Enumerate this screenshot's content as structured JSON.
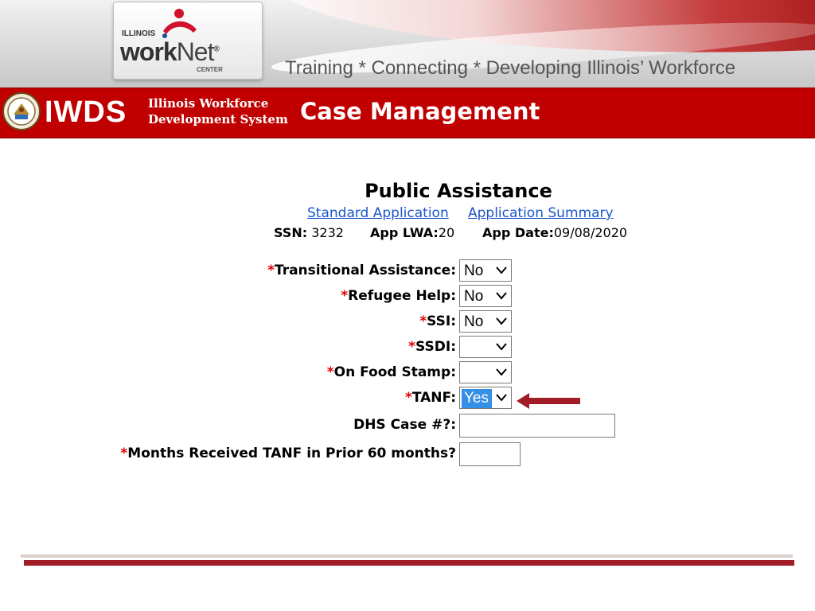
{
  "header": {
    "logo_state": "ILLINOIS",
    "logo_work": "work",
    "logo_net": "Net",
    "logo_trademark": "®",
    "logo_center": "CENTER",
    "tagline": "Training * Connecting * Developing Illinois’ Workforce"
  },
  "system_bar": {
    "acronym": "IWDS",
    "full_name_line1": "Illinois Workforce",
    "full_name_line2": "Development System",
    "module": "Case Management"
  },
  "page": {
    "title": "Public Assistance",
    "links": {
      "standard_application": "Standard Application",
      "application_summary": "Application Summary"
    },
    "info": {
      "ssn_label": "SSN:",
      "ssn_value": "3232",
      "lwa_label": "App LWA:",
      "lwa_value": "20",
      "date_label": "App Date:",
      "date_value": "09/08/2020"
    }
  },
  "form": {
    "required_marker": "*",
    "fields": [
      {
        "label": "Transitional Assistance:",
        "value": "No",
        "required": true
      },
      {
        "label": "Refugee Help:",
        "value": "No",
        "required": true
      },
      {
        "label": "SSI:",
        "value": "No",
        "required": true
      },
      {
        "label": "SSDI:",
        "value": "",
        "required": true
      },
      {
        "label": "On Food Stamp:",
        "value": "",
        "required": true
      },
      {
        "label": "TANF:",
        "value": "Yes",
        "required": true
      },
      {
        "label": "DHS Case #?:",
        "value": "",
        "required": false
      },
      {
        "label": "Months Received TANF in Prior 60 months?",
        "value": "",
        "required": true
      }
    ]
  },
  "colors": {
    "brand_red": "#c00000",
    "link_blue": "#1a56c9",
    "required_red": "#e00000",
    "selection_blue": "#3390e6",
    "arrow_red": "#a01c26"
  },
  "icons": [
    "illinois-seal-icon",
    "worknet-figure-icon",
    "chevron-down-icon",
    "arrow-left-icon"
  ]
}
